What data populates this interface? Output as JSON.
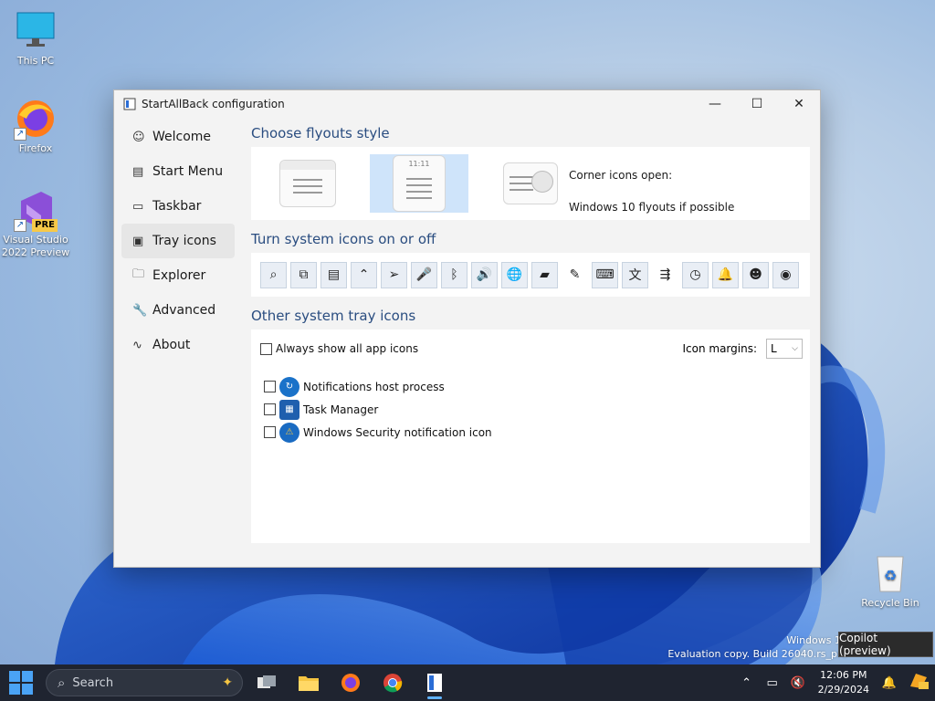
{
  "desktop": {
    "icons": [
      {
        "label": "This PC"
      },
      {
        "label": "Firefox"
      },
      {
        "label": "Visual Studio\n2022 Preview",
        "badge": "PRE"
      },
      {
        "label": "Recycle Bin"
      }
    ]
  },
  "window": {
    "title": "StartAllBack configuration",
    "controls": {
      "minimize": "—",
      "maximize": "☐",
      "close": "✕"
    },
    "sidebar": [
      {
        "label": "Welcome",
        "icon": "smile-icon",
        "glyph": "☺"
      },
      {
        "label": "Start Menu",
        "icon": "start-menu-icon",
        "glyph": "▤"
      },
      {
        "label": "Taskbar",
        "icon": "taskbar-icon",
        "glyph": "▭"
      },
      {
        "label": "Tray icons",
        "icon": "tray-icon",
        "glyph": "▣",
        "active": true
      },
      {
        "label": "Explorer",
        "icon": "folder-icon",
        "glyph": "🗀"
      },
      {
        "label": "Advanced",
        "icon": "wrench-icon",
        "glyph": "🔧"
      },
      {
        "label": "About",
        "icon": "about-icon",
        "glyph": "∿"
      }
    ],
    "flyouts": {
      "heading": "Choose flyouts style",
      "corner_label": "Corner icons open:",
      "corner_value": "Windows 10 flyouts if possible",
      "selected_index": 1,
      "clock_text": "11:11"
    },
    "system_icons": {
      "heading": "Turn system icons on or off",
      "icons": [
        {
          "name": "search-icon",
          "glyph": "⌕",
          "on": true
        },
        {
          "name": "task-view-icon",
          "glyph": "⧉",
          "on": true
        },
        {
          "name": "widgets-icon",
          "glyph": "▤",
          "on": true
        },
        {
          "name": "chevron-up-icon",
          "glyph": "⌃",
          "on": true
        },
        {
          "name": "location-icon",
          "glyph": "➢",
          "on": true
        },
        {
          "name": "microphone-icon",
          "glyph": "🎤",
          "on": true
        },
        {
          "name": "bluetooth-icon",
          "glyph": "ᛒ",
          "on": true
        },
        {
          "name": "volume-icon",
          "glyph": "🔊",
          "on": true
        },
        {
          "name": "globe-icon",
          "glyph": "🌐",
          "on": true
        },
        {
          "name": "battery-icon",
          "glyph": "▰",
          "on": true
        },
        {
          "name": "pen-icon",
          "glyph": "✎",
          "on": false
        },
        {
          "name": "keyboard-icon",
          "glyph": "⌨",
          "on": true
        },
        {
          "name": "language-icon",
          "glyph": "文",
          "on": true
        },
        {
          "name": "mixer-icon",
          "glyph": "⇶",
          "on": false
        },
        {
          "name": "clock-icon",
          "glyph": "◷",
          "on": true
        },
        {
          "name": "bell-icon",
          "glyph": "🔔",
          "on": true
        },
        {
          "name": "meet-icon",
          "glyph": "☻",
          "on": true
        },
        {
          "name": "eye-icon",
          "glyph": "◉",
          "on": true
        }
      ]
    },
    "other_tray": {
      "heading": "Other system tray icons",
      "always_show_label": "Always show all app icons",
      "margins_label": "Icon margins:",
      "margins_value": "L",
      "apps": [
        {
          "label": "Notifications host process",
          "checked": false
        },
        {
          "label": "Task Manager",
          "checked": false
        },
        {
          "label": "Windows Security notification icon",
          "checked": false
        }
      ]
    }
  },
  "watermark": {
    "line1": "Windows 11",
    "line2": "Evaluation copy. Build 26040.rs_pre"
  },
  "tooltip": "Copilot (preview)",
  "taskbar": {
    "search_placeholder": "Search",
    "time": "12:06 PM",
    "date": "2/29/2024"
  }
}
